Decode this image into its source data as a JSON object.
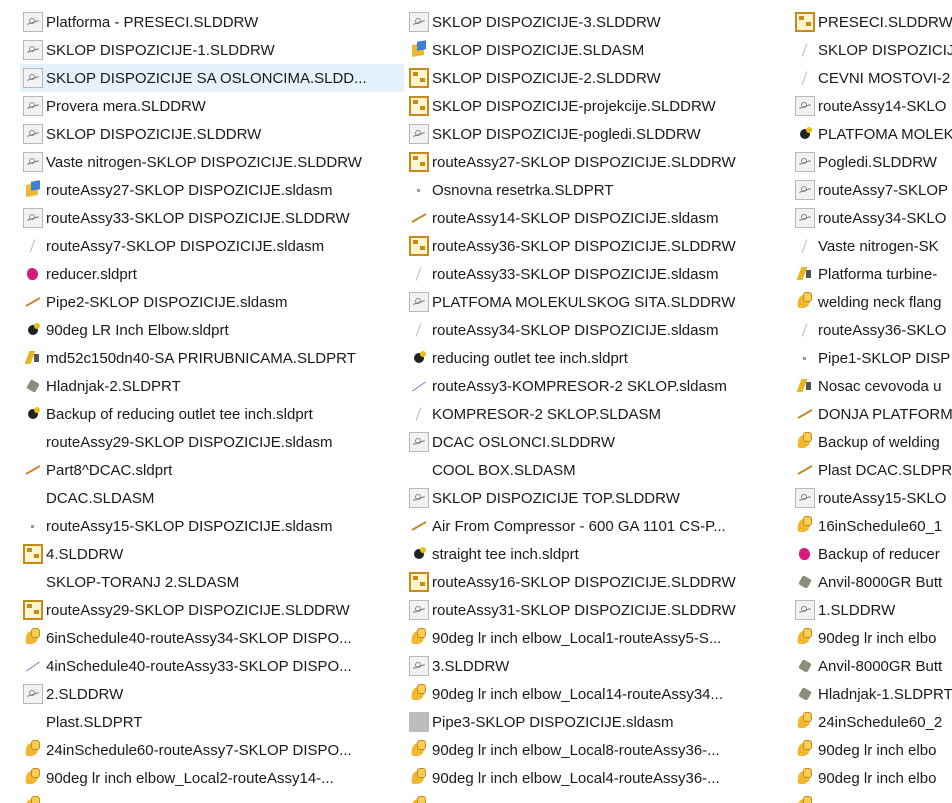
{
  "columns": [
    {
      "items": [
        {
          "label": "Platforma - PRESECI.SLDDRW",
          "icon": "drawing-sketch-icon"
        },
        {
          "label": "SKLOP DISPOZICIJE-1.SLDDRW",
          "icon": "drawing-sketch-icon"
        },
        {
          "label": "SKLOP DISPOZICIJE SA OSLONCIMA.SLDD...",
          "icon": "drawing-sketch-icon",
          "selected": true
        },
        {
          "label": "Provera mera.SLDDRW",
          "icon": "drawing-sketch-icon"
        },
        {
          "label": "SKLOP DISPOZICIJE.SLDDRW",
          "icon": "drawing-sketch-icon"
        },
        {
          "label": "Vaste nitrogen-SKLOP DISPOZICIJE.SLDDRW",
          "icon": "drawing-sketch-icon"
        },
        {
          "label": "routeAssy27-SKLOP DISPOZICIJE.sldasm",
          "icon": "assembly-blue-icon"
        },
        {
          "label": "routeAssy33-SKLOP DISPOZICIJE.SLDDRW",
          "icon": "drawing-sketch-icon"
        },
        {
          "label": "routeAssy7-SKLOP DISPOZICIJE.sldasm",
          "icon": "thin-part-icon"
        },
        {
          "label": "reducer.sldprt",
          "icon": "pink-part-icon"
        },
        {
          "label": "Pipe2-SKLOP DISPOZICIJE.sldasm",
          "icon": "pipe-line-icon"
        },
        {
          "label": "90deg LR Inch Elbow.sldprt",
          "icon": "black-elbow-icon"
        },
        {
          "label": "md52c150dn40-SA PRIRUBNICAMA.SLDPRT",
          "icon": "flange-part-icon"
        },
        {
          "label": "Hladnjak-2.SLDPRT",
          "icon": "gray-part-icon"
        },
        {
          "label": "Backup of reducing outlet tee inch.sldprt",
          "icon": "black-elbow-icon"
        },
        {
          "label": "routeAssy29-SKLOP DISPOZICIJE.sldasm",
          "icon": "blank-icon"
        },
        {
          "label": "Part8^DCAC.sldprt",
          "icon": "pipe-line-icon"
        },
        {
          "label": "DCAC.SLDASM",
          "icon": "blank-icon"
        },
        {
          "label": "routeAssy15-SKLOP DISPOZICIJE.sldasm",
          "icon": "dot-icon"
        },
        {
          "label": "4.SLDDRW",
          "icon": "drawing-frame-icon"
        },
        {
          "label": "SKLOP-TORANJ 2.SLDASM",
          "icon": "blank-icon"
        },
        {
          "label": "routeAssy29-SKLOP DISPOZICIJE.SLDDRW",
          "icon": "drawing-frame-icon"
        },
        {
          "label": "6inSchedule40-routeAssy34-SKLOP DISPO...",
          "icon": "assembly-icon"
        },
        {
          "label": "4inSchedule40-routeAssy33-SKLOP DISPO...",
          "icon": "line-part-icon"
        },
        {
          "label": "2.SLDDRW",
          "icon": "drawing-sketch-icon"
        },
        {
          "label": "Plast.SLDPRT",
          "icon": "blank-icon"
        },
        {
          "label": "24inSchedule60-routeAssy7-SKLOP DISPO...",
          "icon": "assembly-icon"
        },
        {
          "label": "90deg lr inch elbow_Local2-routeAssy14-...",
          "icon": "assembly-icon"
        },
        {
          "label": "",
          "icon": "assembly-icon"
        }
      ]
    },
    {
      "items": [
        {
          "label": "SKLOP DISPOZICIJE-3.SLDDRW",
          "icon": "drawing-sketch-icon"
        },
        {
          "label": "SKLOP DISPOZICIJE.SLDASM",
          "icon": "assembly-blue-icon"
        },
        {
          "label": "SKLOP DISPOZICIJE-2.SLDDRW",
          "icon": "drawing-frame-icon"
        },
        {
          "label": "SKLOP DISPOZICIJE-projekcije.SLDDRW",
          "icon": "drawing-frame-icon"
        },
        {
          "label": "SKLOP DISPOZICIJE-pogledi.SLDDRW",
          "icon": "drawing-sketch-icon"
        },
        {
          "label": "routeAssy27-SKLOP DISPOZICIJE.SLDDRW",
          "icon": "drawing-frame-icon"
        },
        {
          "label": "Osnovna resetrka.SLDPRT",
          "icon": "dot-icon"
        },
        {
          "label": "routeAssy14-SKLOP DISPOZICIJE.sldasm",
          "icon": "pipe-line-icon"
        },
        {
          "label": "routeAssy36-SKLOP DISPOZICIJE.SLDDRW",
          "icon": "drawing-frame-icon"
        },
        {
          "label": "routeAssy33-SKLOP DISPOZICIJE.sldasm",
          "icon": "thin-part-icon"
        },
        {
          "label": "PLATFOMA MOLEKULSKOG SITA.SLDDRW",
          "icon": "drawing-sketch-icon"
        },
        {
          "label": "routeAssy34-SKLOP DISPOZICIJE.sldasm",
          "icon": "thin-part-icon"
        },
        {
          "label": "reducing outlet tee inch.sldprt",
          "icon": "black-elbow-icon"
        },
        {
          "label": "routeAssy3-KOMPRESOR-2 SKLOP.sldasm",
          "icon": "line-part-icon"
        },
        {
          "label": "KOMPRESOR-2 SKLOP.SLDASM",
          "icon": "thin-part-icon"
        },
        {
          "label": "DCAC OSLONCI.SLDDRW",
          "icon": "drawing-sketch-icon"
        },
        {
          "label": "COOL BOX.SLDASM",
          "icon": "blank-icon"
        },
        {
          "label": "SKLOP DISPOZICIJE TOP.SLDDRW",
          "icon": "drawing-sketch-icon"
        },
        {
          "label": "Air From Compressor - 600 GA 1101 CS-P...",
          "icon": "pipe-line-icon"
        },
        {
          "label": "straight tee inch.sldprt",
          "icon": "black-elbow-icon"
        },
        {
          "label": "routeAssy16-SKLOP DISPOZICIJE.SLDDRW",
          "icon": "drawing-frame-icon"
        },
        {
          "label": "routeAssy31-SKLOP DISPOZICIJE.SLDDRW",
          "icon": "drawing-sketch-icon"
        },
        {
          "label": "90deg lr inch elbow_Local1-routeAssy5-S...",
          "icon": "assembly-icon"
        },
        {
          "label": "3.SLDDRW",
          "icon": "drawing-sketch-icon"
        },
        {
          "label": "90deg lr inch elbow_Local14-routeAssy34...",
          "icon": "assembly-icon"
        },
        {
          "label": "Pipe3-SKLOP DISPOZICIJE.sldasm",
          "icon": "gray-box-icon"
        },
        {
          "label": "90deg lr inch elbow_Local8-routeAssy36-...",
          "icon": "assembly-icon"
        },
        {
          "label": "90deg lr inch elbow_Local4-routeAssy36-...",
          "icon": "assembly-icon"
        },
        {
          "label": "",
          "icon": "assembly-icon"
        }
      ]
    },
    {
      "items": [
        {
          "label": "PRESECI.SLDDRW",
          "icon": "drawing-frame-icon"
        },
        {
          "label": "SKLOP DISPOZICIJE-",
          "icon": "thin-part-icon"
        },
        {
          "label": "CEVNI MOSTOVI-2",
          "icon": "thin-part-icon"
        },
        {
          "label": "routeAssy14-SKLO",
          "icon": "drawing-sketch-icon"
        },
        {
          "label": "PLATFOMA MOLEK",
          "icon": "black-elbow-icon"
        },
        {
          "label": "Pogledi.SLDDRW",
          "icon": "drawing-sketch-icon"
        },
        {
          "label": "routeAssy7-SKLOP",
          "icon": "drawing-sketch-icon"
        },
        {
          "label": "routeAssy34-SKLO",
          "icon": "drawing-sketch-icon"
        },
        {
          "label": "Vaste nitrogen-SK",
          "icon": "thin-part-icon"
        },
        {
          "label": "Platforma turbine-",
          "icon": "flange-part-icon"
        },
        {
          "label": "welding neck flang",
          "icon": "assembly-icon"
        },
        {
          "label": "routeAssy36-SKLO",
          "icon": "thin-part-icon"
        },
        {
          "label": "Pipe1-SKLOP DISP",
          "icon": "dot-icon"
        },
        {
          "label": "Nosac cevovoda u",
          "icon": "flange-part-icon"
        },
        {
          "label": "DONJA PLATFORM",
          "icon": "pipe-line-icon"
        },
        {
          "label": "Backup of welding",
          "icon": "assembly-icon"
        },
        {
          "label": "Plast DCAC.SLDPR",
          "icon": "pipe-line-icon"
        },
        {
          "label": "routeAssy15-SKLO",
          "icon": "drawing-sketch-icon"
        },
        {
          "label": "16inSchedule60_1",
          "icon": "assembly-icon"
        },
        {
          "label": "Backup of reducer",
          "icon": "pink-part-icon"
        },
        {
          "label": "Anvil-8000GR Butt",
          "icon": "gray-part-icon"
        },
        {
          "label": "1.SLDDRW",
          "icon": "drawing-sketch-icon"
        },
        {
          "label": "90deg lr inch elbo",
          "icon": "assembly-icon"
        },
        {
          "label": "Anvil-8000GR Butt",
          "icon": "gray-part-icon"
        },
        {
          "label": "Hladnjak-1.SLDPRT",
          "icon": "gray-part-icon"
        },
        {
          "label": "24inSchedule60_2",
          "icon": "assembly-icon"
        },
        {
          "label": "90deg lr inch elbo",
          "icon": "assembly-icon"
        },
        {
          "label": "90deg lr inch elbo",
          "icon": "assembly-icon"
        },
        {
          "label": "",
          "icon": "assembly-icon"
        }
      ]
    }
  ]
}
